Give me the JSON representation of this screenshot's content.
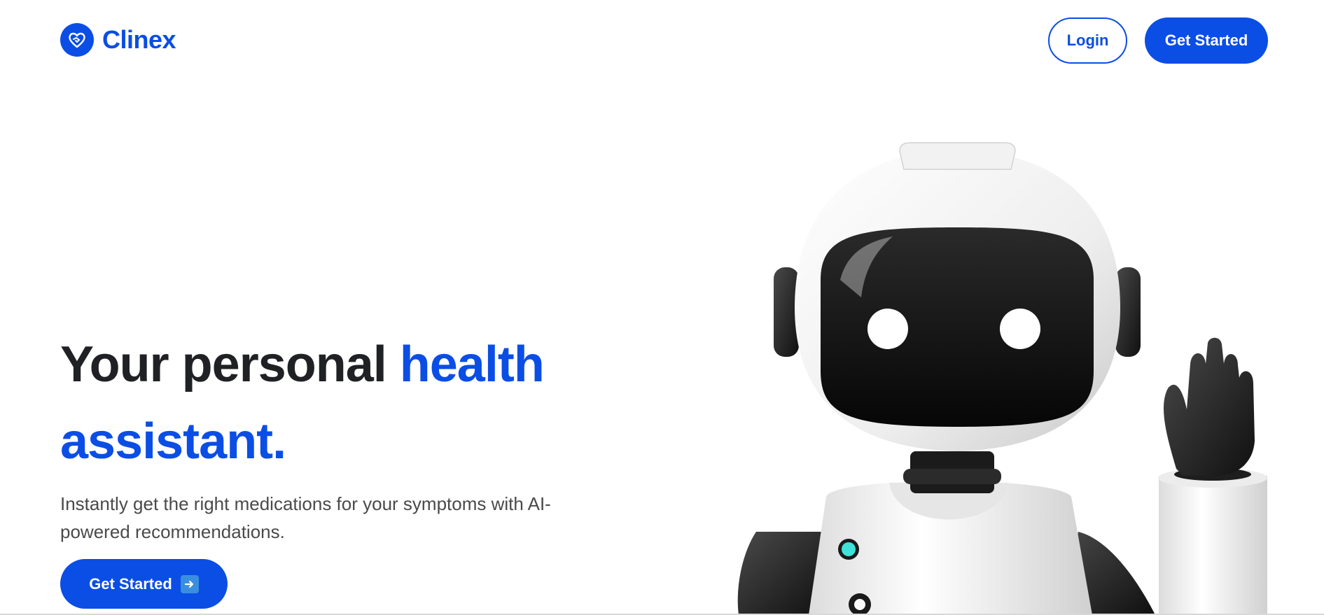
{
  "header": {
    "brand_name": "Clinex",
    "login_label": "Login",
    "get_started_label": "Get Started"
  },
  "hero": {
    "title_part1": "Your personal ",
    "title_accent": "health assistant.",
    "subtitle": "Instantly get the right medications for your symptoms with AI-powered recommendations.",
    "cta_label": "Get Started",
    "cta_icon": "arrow-right-icon"
  },
  "colors": {
    "accent": "#0b4ee5",
    "text_dark": "#202124",
    "text_muted": "#4a4a4a"
  },
  "illustration": {
    "name": "waving-robot-illustration"
  }
}
